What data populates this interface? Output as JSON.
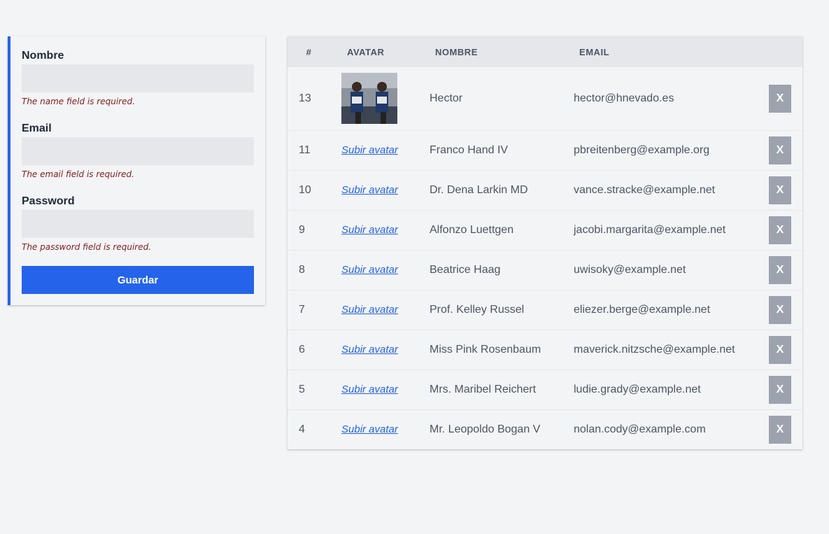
{
  "form": {
    "name_label": "Nombre",
    "name_value": "",
    "name_error": "The name field is required.",
    "email_label": "Email",
    "email_value": "",
    "email_error": "The email field is required.",
    "password_label": "Password",
    "password_value": "",
    "password_error": "The password field is required.",
    "save_label": "Guardar"
  },
  "table": {
    "headers": {
      "id": "#",
      "avatar": "AVATAR",
      "name": "NOMBRE",
      "email": "EMAIL"
    },
    "upload_label": "Subir avatar",
    "delete_label": "X",
    "rows": [
      {
        "id": "13",
        "has_avatar": true,
        "name": "Hector",
        "email": "hector@hnevado.es"
      },
      {
        "id": "11",
        "has_avatar": false,
        "name": "Franco Hand IV",
        "email": "pbreitenberg@example.org"
      },
      {
        "id": "10",
        "has_avatar": false,
        "name": "Dr. Dena Larkin MD",
        "email": "vance.stracke@example.net"
      },
      {
        "id": "9",
        "has_avatar": false,
        "name": "Alfonzo Luettgen",
        "email": "jacobi.margarita@example.net"
      },
      {
        "id": "8",
        "has_avatar": false,
        "name": "Beatrice Haag",
        "email": "uwisoky@example.net"
      },
      {
        "id": "7",
        "has_avatar": false,
        "name": "Prof. Kelley Russel",
        "email": "eliezer.berge@example.net"
      },
      {
        "id": "6",
        "has_avatar": false,
        "name": "Miss Pink Rosenbaum",
        "email": "maverick.nitzsche@example.net"
      },
      {
        "id": "5",
        "has_avatar": false,
        "name": "Mrs. Maribel Reichert",
        "email": "ludie.grady@example.net"
      },
      {
        "id": "4",
        "has_avatar": false,
        "name": "Mr. Leopoldo Bogan V",
        "email": "nolan.cody@example.com"
      }
    ]
  }
}
